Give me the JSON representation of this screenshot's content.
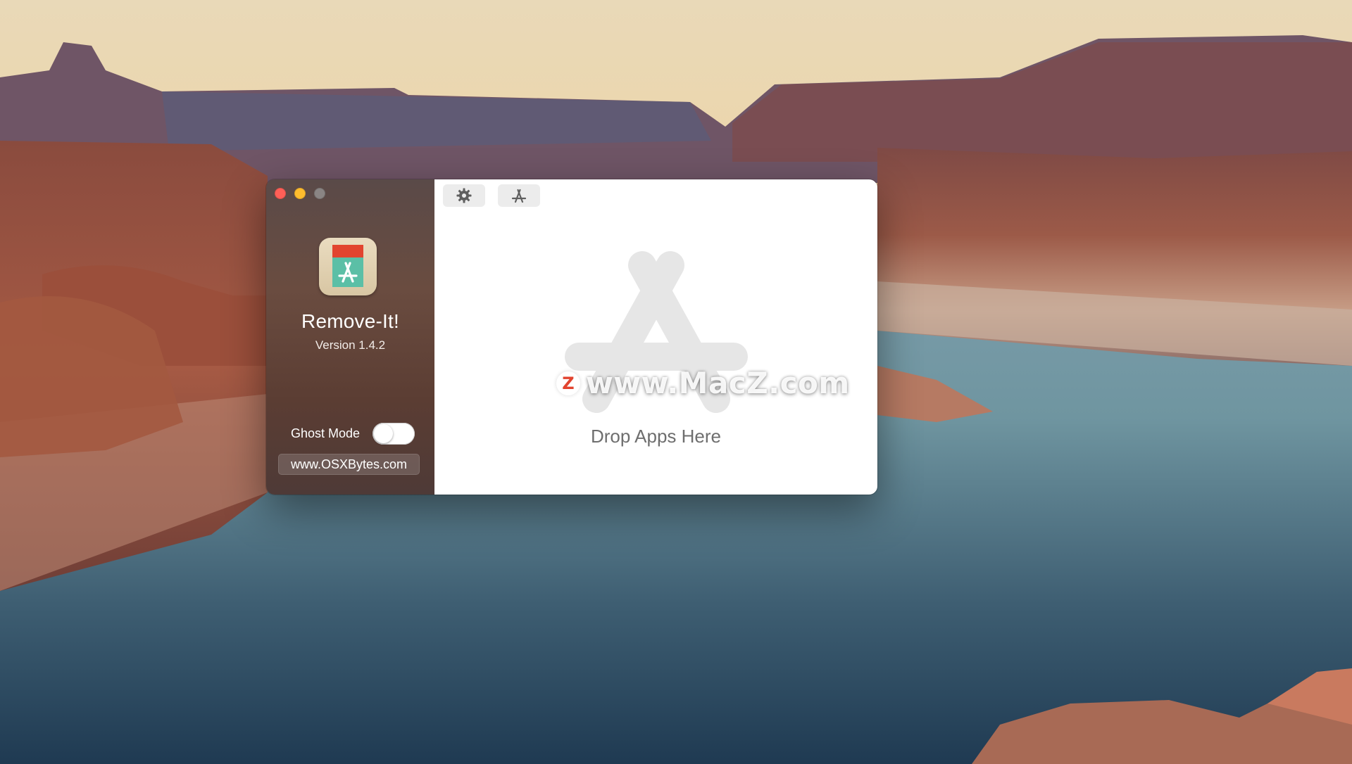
{
  "desktop": {
    "wallpaper": "canyon-lake-sunset"
  },
  "window": {
    "traffic_lights": {
      "close_color": "#fe5f57",
      "minimize_color": "#febc2e",
      "zoom_color": "#8a8584"
    },
    "sidebar": {
      "app_icon": "remove-it-app-icon",
      "app_name": "Remove-It!",
      "version": "Version 1.4.2",
      "ghost_mode_label": "Ghost Mode",
      "ghost_mode_on": false,
      "website_label": "www.OSXBytes.com"
    },
    "toolbar": {
      "settings_icon": "gear-icon",
      "appstore_icon": "app-store-icon"
    },
    "main": {
      "drop_icon": "app-store-icon",
      "drop_label": "Drop Apps Here"
    }
  },
  "watermark": {
    "logo_letter": "Z",
    "text": "www.MacZ.com"
  },
  "colors": {
    "sidebar_top": "#5a4a48",
    "sidebar_bottom": "#4e3a37",
    "drop_label": "#6e6e6e",
    "icon_teal": "#5bbfa6",
    "icon_red": "#e2442f"
  }
}
